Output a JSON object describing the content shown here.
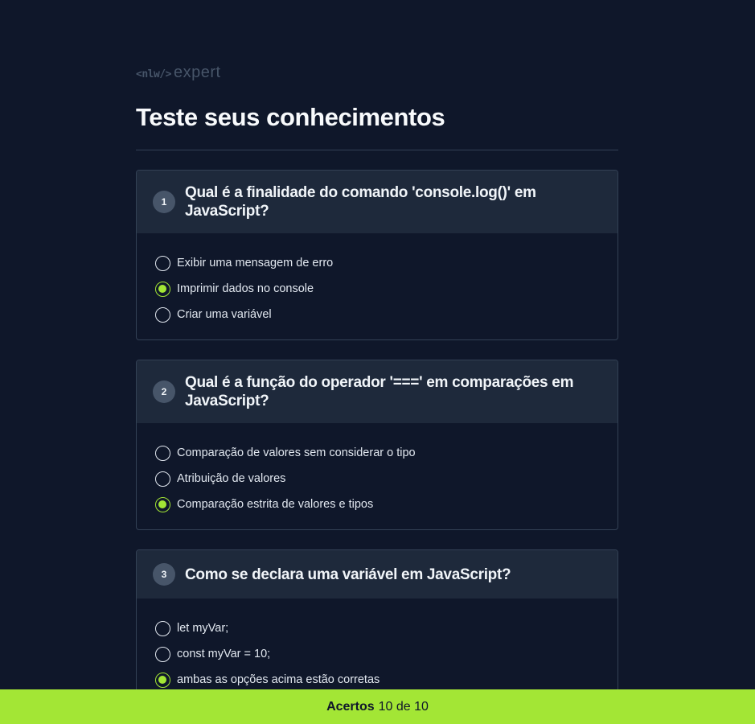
{
  "logo": {
    "code": "<nlw/>",
    "word": "expert"
  },
  "page_title": "Teste seus conhecimentos",
  "questions": [
    {
      "number": "1",
      "text": "Qual é a finalidade do comando 'console.log()' em JavaScript?",
      "options": [
        {
          "label": "Exibir uma mensagem de erro",
          "selected": false
        },
        {
          "label": "Imprimir dados no console",
          "selected": true
        },
        {
          "label": "Criar uma variável",
          "selected": false
        }
      ]
    },
    {
      "number": "2",
      "text": "Qual é a função do operador '===' em comparações em JavaScript?",
      "options": [
        {
          "label": "Comparação de valores sem considerar o tipo",
          "selected": false
        },
        {
          "label": "Atribuição de valores",
          "selected": false
        },
        {
          "label": "Comparação estrita de valores e tipos",
          "selected": true
        }
      ]
    },
    {
      "number": "3",
      "text": "Como se declara uma variável em JavaScript?",
      "options": [
        {
          "label": "let myVar;",
          "selected": false
        },
        {
          "label": "const myVar = 10;",
          "selected": false
        },
        {
          "label": "ambas as opções acima estão corretas",
          "selected": true
        }
      ]
    }
  ],
  "footer": {
    "label": "Acertos",
    "value": "10 de 10"
  },
  "colors": {
    "background": "#0f172a",
    "card_header": "#1e293b",
    "accent": "#a3e635"
  }
}
